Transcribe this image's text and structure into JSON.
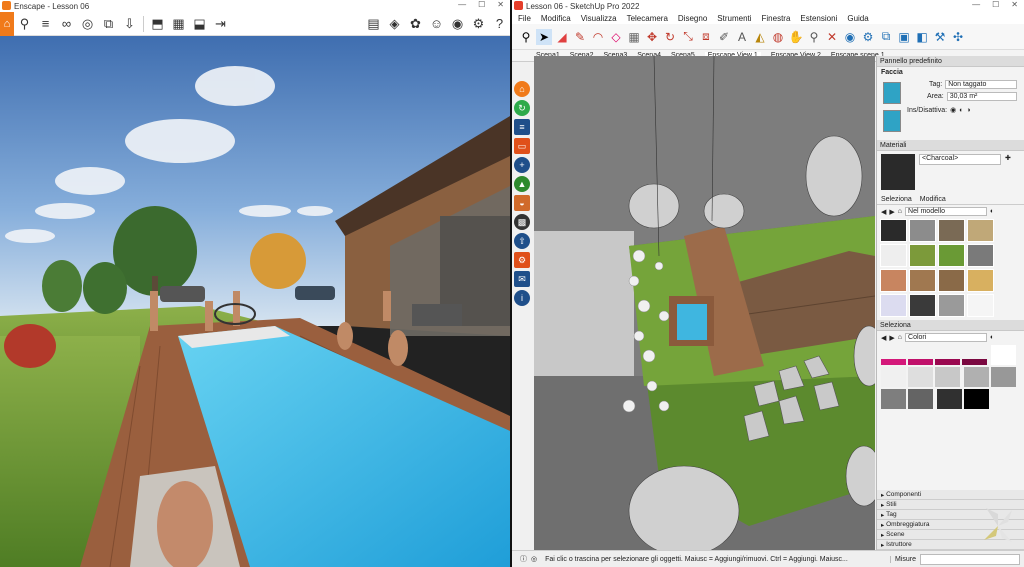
{
  "enscape": {
    "title": "Enscape - Lesson 06",
    "window_controls": [
      "—",
      "☐",
      "✕"
    ],
    "toolbar_glyphs": [
      "⌂",
      "⚲",
      "≡",
      "∞",
      "◎",
      "⧉",
      "⇩",
      "⬒",
      "▦",
      "⬓",
      "⇥",
      "▤",
      "◈",
      "✿",
      "☺",
      "◉",
      "⚙",
      "?"
    ]
  },
  "sketchup": {
    "title": "Lesson 06 - SketchUp Pro 2022",
    "window_controls": [
      "—",
      "☐",
      "✕"
    ],
    "menu": [
      "File",
      "Modifica",
      "Visualizza",
      "Telecamera",
      "Disegno",
      "Strumenti",
      "Finestra",
      "Estensioni",
      "Guida"
    ],
    "scene_tabs": [
      "Scena1",
      "Scena2",
      "Scena3",
      "Scena4",
      "Scena5",
      "Enscape View 1",
      "Enscape View 2",
      "Enscape scene 1"
    ],
    "active_tab_index": 5,
    "panel": {
      "title": "Pannello predefinito",
      "face_section": "Faccia",
      "tag_label": "Tag:",
      "tag_value": "Non taggato",
      "area_label": "Area:",
      "area_value": "30,03 m²",
      "toggle_label": "Ins/Disattiva:",
      "materials_header": "Materiali",
      "material_name": "<Charcoal>",
      "select_tab": "Seleziona",
      "edit_tab": "Modifica",
      "library_value": "Nel modello",
      "select_header": "Seleziona",
      "colors_value": "Colori",
      "folds": [
        "Componenti",
        "Stili",
        "Tag",
        "Ombreggiatura",
        "Scene",
        "Istruttore"
      ]
    },
    "status_text": "Fai clic o trascina per selezionare gli oggetti. Maiusc = Aggiungi/rimuovi. Ctrl = Aggiungi. Maiusc...",
    "measure_label": "Misure"
  },
  "colors": {
    "enscape_orange": "#f07a1a",
    "charcoal": "#2a2a2a",
    "grass": "#5c8a2e",
    "roof": "#7a5a42"
  }
}
